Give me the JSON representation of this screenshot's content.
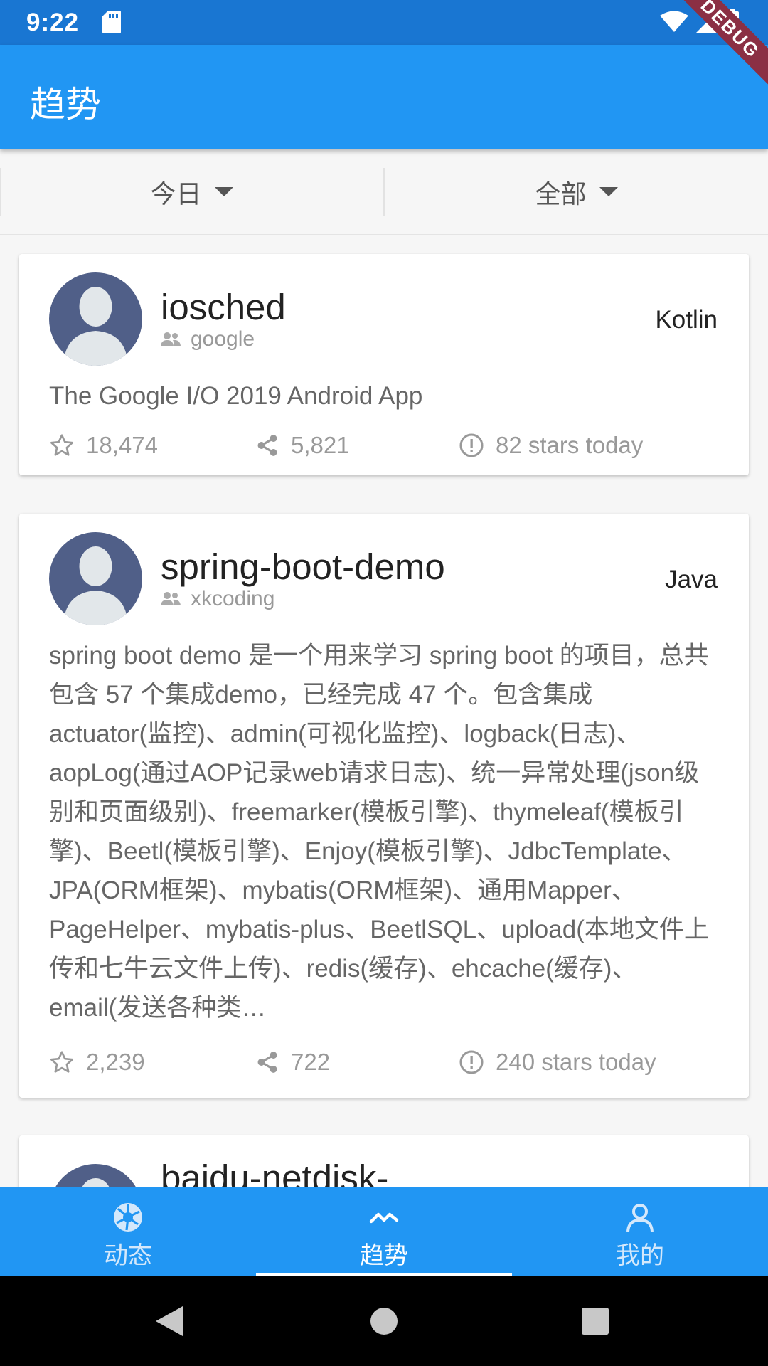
{
  "status_bar": {
    "time": "9:22",
    "debug_label": "DEBUG"
  },
  "app_bar": {
    "title": "趋势"
  },
  "filters": {
    "time_filter": "今日",
    "language_filter": "全部"
  },
  "repos": [
    {
      "name": "iosched",
      "owner": "google",
      "language": "Kotlin",
      "description": "The Google I/O 2019 Android App",
      "stars": "18,474",
      "forks": "5,821",
      "stars_today": "82 stars today"
    },
    {
      "name": "spring-boot-demo",
      "owner": "xkcoding",
      "language": "Java",
      "description": "spring boot demo 是一个用来学习 spring boot 的项目，总共包含 57 个集成demo，已经完成 47 个。包含集成 actuator(监控)、admin(可视化监控)、logback(日志)、aopLog(通过AOP记录web请求日志)、统一异常处理(json级别和页面级别)、freemarker(模板引擎)、thymeleaf(模板引擎)、Beetl(模板引擎)、Enjoy(模板引擎)、JdbcTemplate、JPA(ORM框架)、mybatis(ORM框架)、通用Mapper、PageHelper、mybatis-plus、BeetlSQL、upload(本地文件上传和七牛云文件上传)、redis(缓存)、ehcache(缓存)、email(发送各种类…",
      "stars": "2,239",
      "forks": "722",
      "stars_today": "240 stars today"
    },
    {
      "name": "baidu-netdisk-"
    }
  ],
  "bottom_nav": [
    {
      "label": "动态",
      "icon": "aperture-icon"
    },
    {
      "label": "趋势",
      "icon": "trending-icon"
    },
    {
      "label": "我的",
      "icon": "person-icon"
    }
  ],
  "colors": {
    "primary": "#2196f3",
    "status_bar": "#1976d2",
    "avatar": "#505f88"
  }
}
